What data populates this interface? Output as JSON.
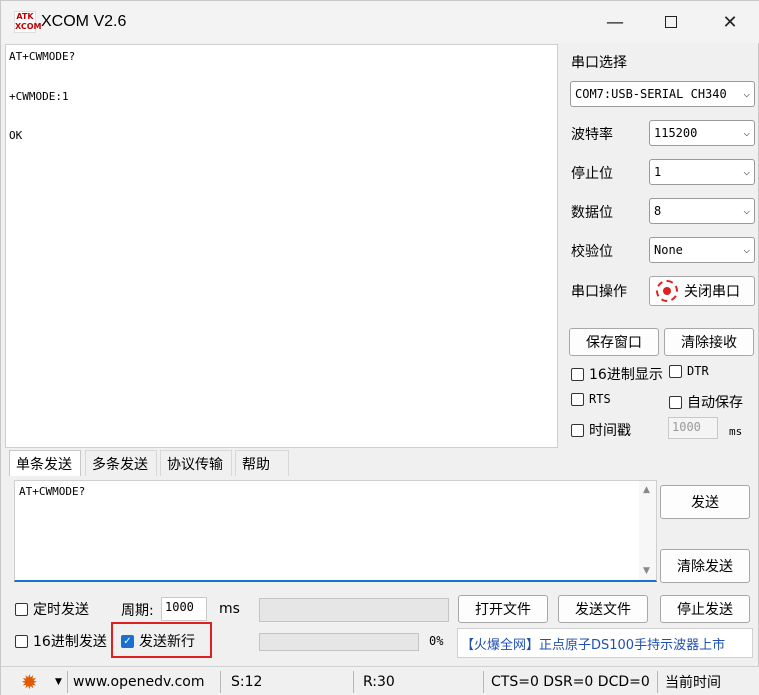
{
  "window": {
    "logo_text": "ATK XCOM",
    "title": "XCOM V2.6",
    "min_symbol": "—",
    "close_symbol": "✕"
  },
  "receive": {
    "lines": [
      "AT+CWMODE?",
      "+CWMODE:1",
      "OK"
    ]
  },
  "serial": {
    "port_select_label": "串口选择",
    "port_value": "COM7:USB-SERIAL CH340",
    "baud_label": "波特率",
    "baud_value": "115200",
    "stop_label": "停止位",
    "stop_value": "1",
    "data_label": "数据位",
    "data_value": "8",
    "parity_label": "校验位",
    "parity_value": "None",
    "op_label": "串口操作",
    "op_button": "关闭串口",
    "led_color": "#e02020"
  },
  "right_panel": {
    "save_window": "保存窗口",
    "clear_receive": "清除接收",
    "hex_display": "16进制显示",
    "dtr": "DTR",
    "rts": "RTS",
    "auto_save": "自动保存",
    "timestamp": "时间戳",
    "timestamp_value": "1000",
    "ms": "ms"
  },
  "tabs": [
    "单条发送",
    "多条发送",
    "协议传输",
    "帮助"
  ],
  "send": {
    "text": "AT+CWMODE?",
    "send_button": "发送",
    "clear_send": "清除发送"
  },
  "bottom": {
    "timed_send": "定时发送",
    "period_label": "周期:",
    "period_value": "1000",
    "ms": "ms",
    "open_file": "打开文件",
    "send_file": "发送文件",
    "stop_send": "停止发送",
    "hex_send": "16进制发送",
    "send_newline": "发送新行",
    "progress_percent": "0%",
    "progress_value": 0,
    "ad_text": "【火爆全网】正点原子DS100手持示波器上市"
  },
  "status": {
    "website": "www.openedv.com",
    "sent": "S:12",
    "received": "R:30",
    "lines": "CTS=0 DSR=0 DCD=0",
    "time": "当前时间 "
  }
}
